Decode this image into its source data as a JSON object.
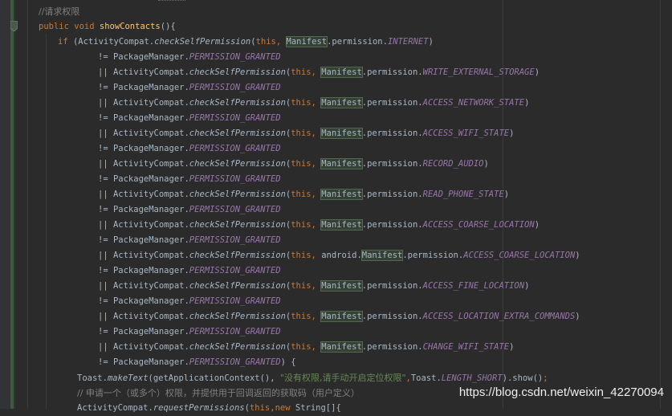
{
  "editor": {
    "language": "Java",
    "theme_colors": {
      "background": "#2b2b2b",
      "keyword": "#cc7832",
      "method_declaration": "#ffc66d",
      "constant": "#9876aa",
      "string": "#6a8759",
      "comment": "#808080",
      "highlight": "#344134"
    },
    "lines": [
      {
        "indent": 48,
        "segments": [
          {
            "t": "//请求权限",
            "c": "cmt"
          }
        ]
      },
      {
        "indent": 48,
        "segments": [
          {
            "t": "public ",
            "c": "kw"
          },
          {
            "t": "void ",
            "c": "kw"
          },
          {
            "t": "showContacts",
            "c": "fn"
          },
          {
            "t": "(){",
            "c": ""
          }
        ]
      },
      {
        "indent": 72,
        "segments": [
          {
            "t": "if ",
            "c": "kw"
          },
          {
            "t": "(ActivityCompat.",
            "c": ""
          },
          {
            "t": "checkSelfPermission",
            "c": "it"
          },
          {
            "t": "(",
            "c": ""
          },
          {
            "t": "this",
            "c": "kw"
          },
          {
            "t": ", ",
            "c": "kw"
          },
          {
            "t": "Manifest",
            "c": "hl"
          },
          {
            "t": ".permission.",
            "c": ""
          },
          {
            "t": "INTERNET",
            "c": "const"
          },
          {
            "t": ")",
            "c": ""
          }
        ]
      },
      {
        "indent": 122,
        "segments": [
          {
            "t": "!= PackageManager.",
            "c": ""
          },
          {
            "t": "PERMISSION_GRANTED",
            "c": "const"
          }
        ]
      },
      {
        "indent": 122,
        "segments": [
          {
            "t": "|| ActivityCompat.",
            "c": ""
          },
          {
            "t": "checkSelfPermission",
            "c": "it"
          },
          {
            "t": "(",
            "c": ""
          },
          {
            "t": "this",
            "c": "kw"
          },
          {
            "t": ", ",
            "c": "kw"
          },
          {
            "t": "Manifest",
            "c": "hl"
          },
          {
            "t": ".permission.",
            "c": ""
          },
          {
            "t": "WRITE_EXTERNAL_STORAGE",
            "c": "const"
          },
          {
            "t": ")",
            "c": ""
          }
        ]
      },
      {
        "indent": 122,
        "segments": [
          {
            "t": "!= PackageManager.",
            "c": ""
          },
          {
            "t": "PERMISSION_GRANTED",
            "c": "const"
          }
        ]
      },
      {
        "indent": 122,
        "segments": [
          {
            "t": "|| ActivityCompat.",
            "c": ""
          },
          {
            "t": "checkSelfPermission",
            "c": "it"
          },
          {
            "t": "(",
            "c": ""
          },
          {
            "t": "this",
            "c": "kw"
          },
          {
            "t": ", ",
            "c": "kw"
          },
          {
            "t": "Manifest",
            "c": "hl"
          },
          {
            "t": ".permission.",
            "c": ""
          },
          {
            "t": "ACCESS_NETWORK_STATE",
            "c": "const"
          },
          {
            "t": ")",
            "c": ""
          }
        ]
      },
      {
        "indent": 122,
        "segments": [
          {
            "t": "!= PackageManager.",
            "c": ""
          },
          {
            "t": "PERMISSION_GRANTED",
            "c": "const"
          }
        ]
      },
      {
        "indent": 122,
        "segments": [
          {
            "t": "|| ActivityCompat.",
            "c": ""
          },
          {
            "t": "checkSelfPermission",
            "c": "it"
          },
          {
            "t": "(",
            "c": ""
          },
          {
            "t": "this",
            "c": "kw"
          },
          {
            "t": ", ",
            "c": "kw"
          },
          {
            "t": "Manifest",
            "c": "hl"
          },
          {
            "t": ".permission.",
            "c": ""
          },
          {
            "t": "ACCESS_WIFI_STATE",
            "c": "const"
          },
          {
            "t": ")",
            "c": ""
          }
        ]
      },
      {
        "indent": 122,
        "segments": [
          {
            "t": "!= PackageManager.",
            "c": ""
          },
          {
            "t": "PERMISSION_GRANTED",
            "c": "const"
          }
        ]
      },
      {
        "indent": 122,
        "segments": [
          {
            "t": "|| ActivityCompat.",
            "c": ""
          },
          {
            "t": "checkSelfPermission",
            "c": "it"
          },
          {
            "t": "(",
            "c": ""
          },
          {
            "t": "this",
            "c": "kw"
          },
          {
            "t": ", ",
            "c": "kw"
          },
          {
            "t": "Manifest",
            "c": "hl"
          },
          {
            "t": ".permission.",
            "c": ""
          },
          {
            "t": "RECORD_AUDIO",
            "c": "const"
          },
          {
            "t": ")",
            "c": ""
          }
        ]
      },
      {
        "indent": 122,
        "segments": [
          {
            "t": "!= PackageManager.",
            "c": ""
          },
          {
            "t": "PERMISSION_GRANTED",
            "c": "const"
          }
        ]
      },
      {
        "indent": 122,
        "segments": [
          {
            "t": "|| ActivityCompat.",
            "c": ""
          },
          {
            "t": "checkSelfPermission",
            "c": "it"
          },
          {
            "t": "(",
            "c": ""
          },
          {
            "t": "this",
            "c": "kw"
          },
          {
            "t": ", ",
            "c": "kw"
          },
          {
            "t": "Manifest",
            "c": "hl"
          },
          {
            "t": ".permission.",
            "c": ""
          },
          {
            "t": "READ_PHONE_STATE",
            "c": "const"
          },
          {
            "t": ")",
            "c": ""
          }
        ]
      },
      {
        "indent": 122,
        "segments": [
          {
            "t": "!= PackageManager.",
            "c": ""
          },
          {
            "t": "PERMISSION_GRANTED",
            "c": "const"
          }
        ]
      },
      {
        "indent": 122,
        "segments": [
          {
            "t": "|| ActivityCompat.",
            "c": ""
          },
          {
            "t": "checkSelfPermission",
            "c": "it"
          },
          {
            "t": "(",
            "c": ""
          },
          {
            "t": "this",
            "c": "kw"
          },
          {
            "t": ", ",
            "c": "kw"
          },
          {
            "t": "Manifest",
            "c": "hl"
          },
          {
            "t": ".permission.",
            "c": ""
          },
          {
            "t": "ACCESS_COARSE_LOCATION",
            "c": "const"
          },
          {
            "t": ")",
            "c": ""
          }
        ]
      },
      {
        "indent": 122,
        "segments": [
          {
            "t": "!= PackageManager.",
            "c": ""
          },
          {
            "t": "PERMISSION_GRANTED",
            "c": "const"
          }
        ]
      },
      {
        "indent": 122,
        "segments": [
          {
            "t": "|| ActivityCompat.",
            "c": ""
          },
          {
            "t": "checkSelfPermission",
            "c": "it"
          },
          {
            "t": "(",
            "c": ""
          },
          {
            "t": "this",
            "c": "kw"
          },
          {
            "t": ", ",
            "c": "kw"
          },
          {
            "t": "android.",
            "c": ""
          },
          {
            "t": "Manifest",
            "c": "hl"
          },
          {
            "t": ".permission.",
            "c": ""
          },
          {
            "t": "ACCESS_COARSE_LOCATION",
            "c": "const"
          },
          {
            "t": ")",
            "c": ""
          }
        ]
      },
      {
        "indent": 122,
        "segments": [
          {
            "t": "!= PackageManager.",
            "c": ""
          },
          {
            "t": "PERMISSION_GRANTED",
            "c": "const"
          }
        ]
      },
      {
        "indent": 122,
        "segments": [
          {
            "t": "|| ActivityCompat.",
            "c": ""
          },
          {
            "t": "checkSelfPermission",
            "c": "it"
          },
          {
            "t": "(",
            "c": ""
          },
          {
            "t": "this",
            "c": "kw"
          },
          {
            "t": ", ",
            "c": "kw"
          },
          {
            "t": "Manifest",
            "c": "hl"
          },
          {
            "t": ".permission.",
            "c": ""
          },
          {
            "t": "ACCESS_FINE_LOCATION",
            "c": "const"
          },
          {
            "t": ")",
            "c": ""
          }
        ]
      },
      {
        "indent": 122,
        "segments": [
          {
            "t": "!= PackageManager.",
            "c": ""
          },
          {
            "t": "PERMISSION_GRANTED",
            "c": "const"
          }
        ]
      },
      {
        "indent": 122,
        "segments": [
          {
            "t": "|| ActivityCompat.",
            "c": ""
          },
          {
            "t": "checkSelfPermission",
            "c": "it"
          },
          {
            "t": "(",
            "c": ""
          },
          {
            "t": "this",
            "c": "kw"
          },
          {
            "t": ", ",
            "c": "kw"
          },
          {
            "t": "Manifest",
            "c": "hl"
          },
          {
            "t": ".permission.",
            "c": ""
          },
          {
            "t": "ACCESS_LOCATION_EXTRA_COMMANDS",
            "c": "const"
          },
          {
            "t": ")",
            "c": ""
          }
        ]
      },
      {
        "indent": 122,
        "segments": [
          {
            "t": "!= PackageManager.",
            "c": ""
          },
          {
            "t": "PERMISSION_GRANTED",
            "c": "const"
          }
        ]
      },
      {
        "indent": 122,
        "segments": [
          {
            "t": "|| ActivityCompat.",
            "c": ""
          },
          {
            "t": "checkSelfPermission",
            "c": "it"
          },
          {
            "t": "(",
            "c": ""
          },
          {
            "t": "this",
            "c": "kw"
          },
          {
            "t": ", ",
            "c": "kw"
          },
          {
            "t": "Manifest",
            "c": "hl"
          },
          {
            "t": ".permission.",
            "c": ""
          },
          {
            "t": "CHANGE_WIFI_STATE",
            "c": "const"
          },
          {
            "t": ")",
            "c": ""
          }
        ]
      },
      {
        "indent": 122,
        "segments": [
          {
            "t": "!= PackageManager.",
            "c": ""
          },
          {
            "t": "PERMISSION_GRANTED",
            "c": "const"
          },
          {
            "t": ") {",
            "c": ""
          }
        ]
      },
      {
        "indent": 96,
        "segments": [
          {
            "t": "Toast.",
            "c": ""
          },
          {
            "t": "makeText",
            "c": "it"
          },
          {
            "t": "(getApplicationContext(), ",
            "c": ""
          },
          {
            "t": "\"没有权限,请手动开启定位权限\"",
            "c": "str"
          },
          {
            "t": ",",
            "c": "kw"
          },
          {
            "t": "Toast.",
            "c": ""
          },
          {
            "t": "LENGTH_SHORT",
            "c": "const"
          },
          {
            "t": ").show()",
            "c": ""
          },
          {
            "t": ";",
            "c": "kw"
          }
        ]
      },
      {
        "indent": 96,
        "segments": [
          {
            "t": "// 申请一个（或多个）权限，并提供用于回调返回的获取码（用户定义）",
            "c": "cmt"
          }
        ]
      },
      {
        "indent": 96,
        "segments": [
          {
            "t": "ActivityCompat.",
            "c": ""
          },
          {
            "t": "requestPermissions",
            "c": "it"
          },
          {
            "t": "(",
            "c": ""
          },
          {
            "t": "this",
            "c": "kw"
          },
          {
            "t": ",",
            "c": "kw"
          },
          {
            "t": "new ",
            "c": "kw"
          },
          {
            "t": "String[]{",
            "c": ""
          }
        ]
      }
    ]
  },
  "watermark": "https://blog.csdn.net/weixin_42270094"
}
